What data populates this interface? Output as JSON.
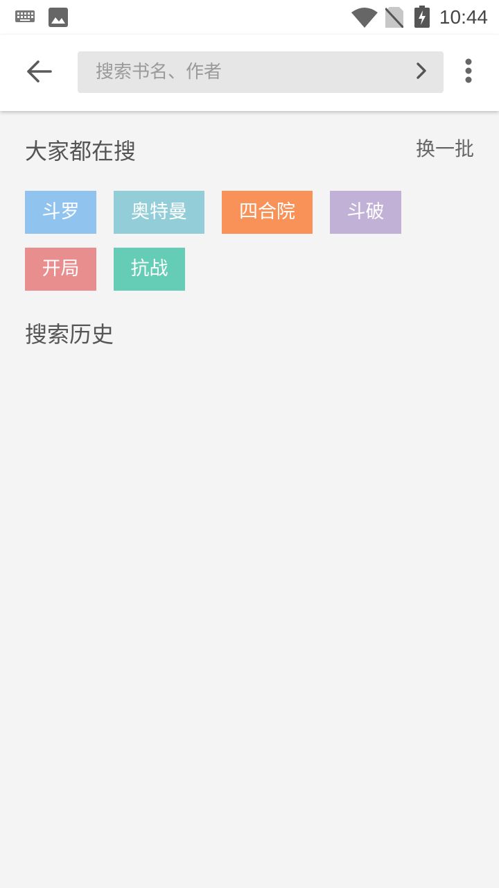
{
  "status_bar": {
    "time": "10:44",
    "icons": [
      "keyboard-icon",
      "image-icon",
      "wifi-icon",
      "no-sim-icon",
      "battery-charging-icon"
    ]
  },
  "app_bar": {
    "back_icon": "arrow-left-icon",
    "search": {
      "placeholder": "搜索书名、作者",
      "value": "",
      "go_icon": "chevron-right-icon"
    },
    "more_icon": "more-vert-icon"
  },
  "hot": {
    "title": "大家都在搜",
    "refresh": "换一批",
    "tags": [
      {
        "label": "斗罗",
        "color": "#90c4ee"
      },
      {
        "label": "奥特曼",
        "color": "#92cdd8"
      },
      {
        "label": "四合院",
        "color": "#f99258"
      },
      {
        "label": "斗破",
        "color": "#c1b1d6"
      },
      {
        "label": "开局",
        "color": "#e88e8f"
      },
      {
        "label": "抗战",
        "color": "#65cdb5"
      }
    ]
  },
  "history": {
    "title": "搜索历史",
    "items": []
  }
}
